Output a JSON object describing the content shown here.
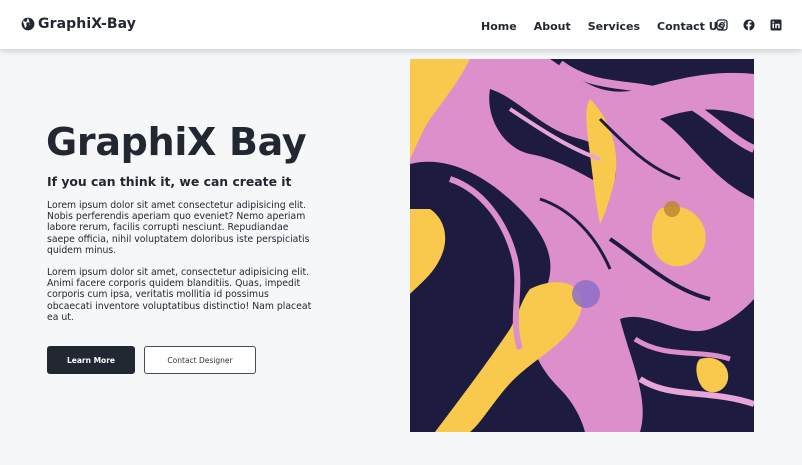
{
  "brand": {
    "name": "GraphiX-Bay",
    "icon": "brand-logo-icon"
  },
  "nav": {
    "links": [
      "Home",
      "About",
      "Services",
      "Contact Us"
    ],
    "socials": [
      "instagram-icon",
      "facebook-icon",
      "linkedin-icon"
    ]
  },
  "hero": {
    "title": "GraphiX Bay",
    "subtitle": "If you can think it, we can create it",
    "paragraphs": [
      "Lorem ipsum dolor sit amet consectetur adipisicing elit. Nobis perferendis aperiam quo eveniet? Nemo aperiam labore rerum, facilis corrupti nesciunt. Repudiandae saepe officia, nihil voluptatem doloribus iste perspiciatis quidem minus.",
      "Lorem ipsum dolor sit amet, consectetur adipisicing elit. Animi facere corporis quidem blanditiis. Quas, impedit corporis cum ipsa, veritatis mollitia id possimus obcaecati inventore voluptatibus distinctio! Nam placeat ea ut."
    ],
    "primary_button": "Learn More",
    "secondary_button": "Contact Designer",
    "image": "abstract-fluid-paint-art"
  },
  "colors": {
    "text": "#222831",
    "background": "#f6f7f9",
    "art_navy": "#1d1b3f",
    "art_pink": "#dc8fcb",
    "art_yellow": "#f9c94d"
  }
}
